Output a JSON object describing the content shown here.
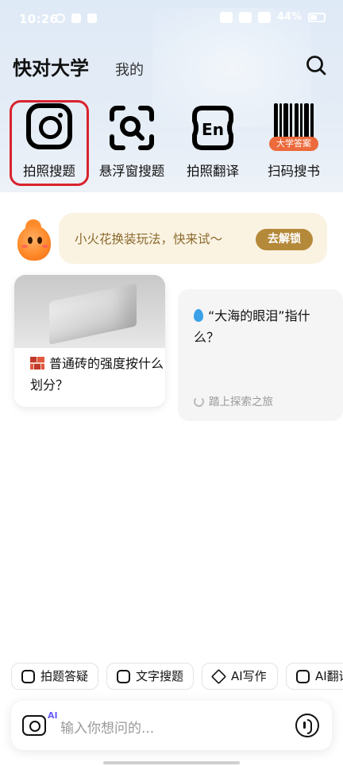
{
  "status_bar": {
    "time": "10:26",
    "battery": "44%"
  },
  "header": {
    "title": "快对大学",
    "tab_mine": "我的"
  },
  "tools": [
    {
      "label": "拍照搜题",
      "icon": "camera-icon",
      "selected": true
    },
    {
      "label": "悬浮窗搜题",
      "icon": "floating-search-icon"
    },
    {
      "label": "拍照翻译",
      "icon": "translate-en-icon"
    },
    {
      "label": "扫码搜书",
      "icon": "barcode-icon",
      "badge": "大学答案"
    }
  ],
  "promo": {
    "text": "小火花换装玩法，快来试～",
    "button": "去解锁"
  },
  "cards": [
    {
      "text": "普通砖的强度按什么划分？",
      "icon": "brick-icon"
    },
    {
      "text": "“大海的眼泪”指什么？",
      "icon": "droplet-icon",
      "footer": "踏上探索之旅"
    }
  ],
  "chips": [
    {
      "label": "拍题答疑",
      "icon": "camera-icon"
    },
    {
      "label": "文字搜题",
      "icon": "doc-search-icon"
    },
    {
      "label": "AI写作",
      "icon": "pen-icon"
    },
    {
      "label": "AI翻译",
      "icon": "translate-icon"
    }
  ],
  "input": {
    "placeholder": "输入你想问的...",
    "ai_badge": "AI"
  },
  "colors": {
    "selected_outline": "#d9232d",
    "promo_bg": "#fbf3e2",
    "promo_button": "#b5893a",
    "badge_orange": "#ec6a3c"
  }
}
